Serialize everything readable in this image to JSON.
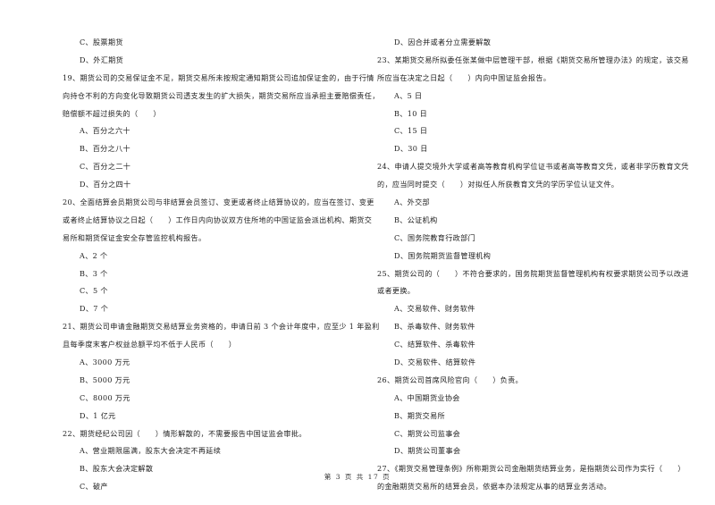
{
  "left_column": [
    {
      "type": "option",
      "text": "C、股票期货"
    },
    {
      "type": "option",
      "text": "D、外汇期货"
    },
    {
      "type": "question",
      "number": "19",
      "lines": [
        "19、期货公司的交易保证金不足，期货交易所未按规定通知期货公司追加保证金的，由于行情",
        "向持仓不利的方向变化导致期货公司透支发生的扩大损失，期货交易所应当承担主要赔偿责任，",
        "赔偿额不超过损失的（　　）"
      ]
    },
    {
      "type": "option",
      "text": "A、百分之六十"
    },
    {
      "type": "option",
      "text": "B、百分之八十"
    },
    {
      "type": "option",
      "text": "C、百分之二十"
    },
    {
      "type": "option",
      "text": "D、百分之四十"
    },
    {
      "type": "question",
      "number": "20",
      "lines": [
        "20、全面结算会员期货公司与非结算会员签订、变更或者终止结算协议的，应当在签订、变更",
        "或者终止结算协议之日起（　　）工作日内向协议双方住所地的中国证监会派出机构、期货交",
        "易所和期货保证金安全存管监控机构报告。"
      ]
    },
    {
      "type": "option",
      "text": "A、2 个"
    },
    {
      "type": "option",
      "text": "B、3 个"
    },
    {
      "type": "option",
      "text": "C、5 个"
    },
    {
      "type": "option",
      "text": "D、7 个"
    },
    {
      "type": "question",
      "number": "21",
      "lines": [
        "21、期货公司申请金融期货交易结算业务资格的，申请日前 3 个会计年度中，应至少 1 年盈利",
        "且每季度末客户权益总额平均不低于人民币（　　）"
      ]
    },
    {
      "type": "option",
      "text": "A、3000 万元"
    },
    {
      "type": "option",
      "text": "B、5000 万元"
    },
    {
      "type": "option",
      "text": "C、8000 万元"
    },
    {
      "type": "option",
      "text": "D、1 亿元"
    },
    {
      "type": "question",
      "number": "22",
      "lines": [
        "22、期货经纪公司因（　　）情形解散的，不需要报告中国证监会审批。"
      ]
    },
    {
      "type": "option",
      "text": "A、营业期限届满，股东大会决定不再延续"
    },
    {
      "type": "option",
      "text": "B、股东大会决定解散"
    },
    {
      "type": "option",
      "text": "C、破产"
    }
  ],
  "right_column": [
    {
      "type": "option",
      "text": "D、因合并或者分立需要解散"
    },
    {
      "type": "question",
      "number": "23",
      "lines": [
        "23、某期货交易所拟委任张某做中层管理干部，根据《期货交易所管理办法》的规定，该交易",
        "所应当在决定之日起（　　）内向中国证监会报告。"
      ]
    },
    {
      "type": "option",
      "text": "A、5 日"
    },
    {
      "type": "option",
      "text": "B、10 日"
    },
    {
      "type": "option",
      "text": "C、15 日"
    },
    {
      "type": "option",
      "text": "D、30 日"
    },
    {
      "type": "question",
      "number": "24",
      "lines": [
        "24、申请人提交境外大学或者高等教育机构学位证书或者高等教育文凭，或者非学历教育文凭",
        "的，应当同时提交（　　）对拟任人所获教育文凭的学历学位认证文件。"
      ]
    },
    {
      "type": "option",
      "text": "A、外交部"
    },
    {
      "type": "option",
      "text": "B、公证机构"
    },
    {
      "type": "option",
      "text": "C、国务院教育行政部门"
    },
    {
      "type": "option",
      "text": "D、国务院期货监督管理机构"
    },
    {
      "type": "question",
      "number": "25",
      "lines": [
        "25、期货公司的（　　）不符合要求的，国务院期货监督管理机构有权要求期货公司予以改进",
        "或者更换。"
      ]
    },
    {
      "type": "option",
      "text": "A、交易软件、财务软件"
    },
    {
      "type": "option",
      "text": "B、杀毒软件、财务软件"
    },
    {
      "type": "option",
      "text": "C、结算软件、杀毒软件"
    },
    {
      "type": "option",
      "text": "D、交易软件、结算软件"
    },
    {
      "type": "question",
      "number": "26",
      "lines": [
        "26、期货公司首席风险官向（　　）负责。"
      ]
    },
    {
      "type": "option",
      "text": "A、中国期货业协会"
    },
    {
      "type": "option",
      "text": "B、期货交易所"
    },
    {
      "type": "option",
      "text": "C、期货公司监事会"
    },
    {
      "type": "option",
      "text": "D、期货公司董事会"
    },
    {
      "type": "question",
      "number": "27",
      "lines": [
        "27、《期货交易管理条例》所称期货公司金融期货结算业务，是指期货公司作为实行（　　）",
        "的金融期货交易所的结算会员，依据本办法规定从事的结算业务活动。"
      ]
    }
  ],
  "footer": {
    "page_label": "第 3 页 共 17 页"
  }
}
